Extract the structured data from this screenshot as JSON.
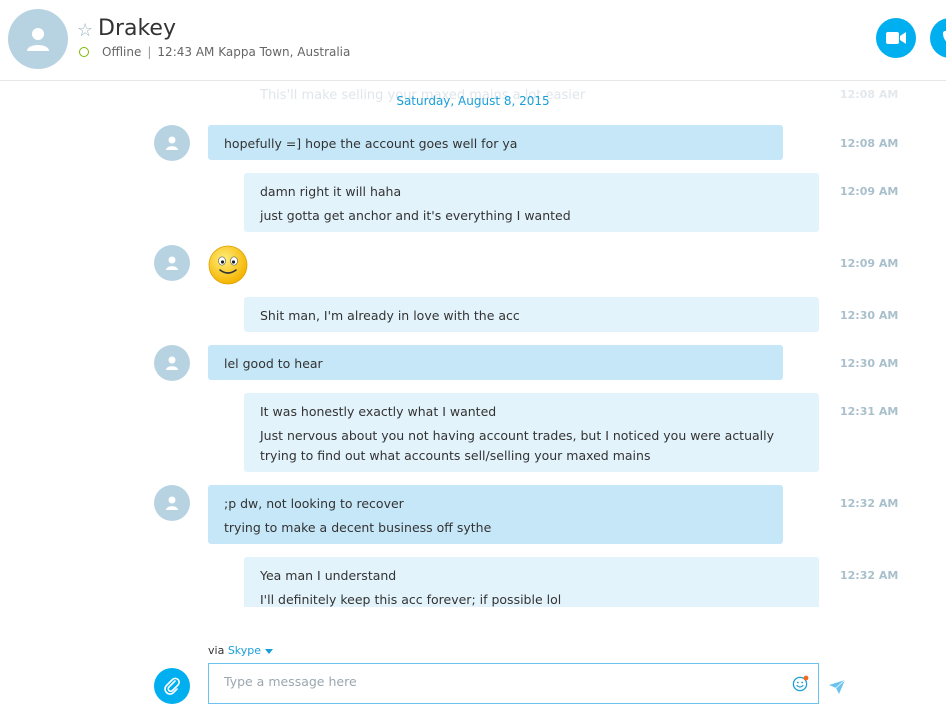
{
  "header": {
    "contact_name": "Drakey",
    "status": "Offline",
    "local_time_location": "12:43 AM Kappa Town, Australia"
  },
  "chat": {
    "faded_preview_text": "This'll make selling your maxed mains a lot easier",
    "faded_preview_time": "12:08 AM",
    "date_divider": "Saturday, August 8, 2015",
    "messages": [
      {
        "direction": "in",
        "lines": [
          "hopefully =] hope the account goes well for ya"
        ],
        "time": "12:08 AM"
      },
      {
        "direction": "out",
        "lines": [
          "damn right it will haha",
          "just gotta get anchor and it's everything I wanted"
        ],
        "time": "12:09 AM"
      },
      {
        "direction": "in",
        "emoji": "smile-emoticon",
        "time": "12:09 AM"
      },
      {
        "direction": "out",
        "lines": [
          "Shit man, I'm already in love with the acc"
        ],
        "time": "12:30 AM"
      },
      {
        "direction": "in",
        "lines": [
          "lel good to hear"
        ],
        "time": "12:30 AM"
      },
      {
        "direction": "out",
        "lines": [
          "It was honestly exactly what I wanted",
          "Just nervous about you not having account trades, but I noticed you were actually trying to find out what accounts sell/selling your maxed mains"
        ],
        "time": "12:31 AM"
      },
      {
        "direction": "in",
        "lines": [
          ";p dw, not looking to recover",
          "trying to make a decent business off sythe"
        ],
        "time": "12:32 AM"
      },
      {
        "direction": "out",
        "lines": [
          "Yea man I understand",
          "I'll definitely keep this acc forever; if possible lol"
        ],
        "time": "12:32 AM"
      }
    ]
  },
  "composer": {
    "via_label": "via",
    "via_service": "Skype",
    "placeholder": "Type a message here"
  },
  "icons": {
    "avatar": "person-icon",
    "favorite": "star-icon",
    "video_call": "video-camera-icon",
    "voice_call": "phone-icon",
    "attach": "paperclip-icon",
    "emoticons": "smiley-icon",
    "send": "send-arrow-icon"
  },
  "colors": {
    "accent": "#00aff0",
    "incoming_bubble": "#c6e7f8",
    "outgoing_bubble": "#e3f3fb",
    "status_offline": "#7fba00",
    "timestamp": "#a9bfcc"
  }
}
